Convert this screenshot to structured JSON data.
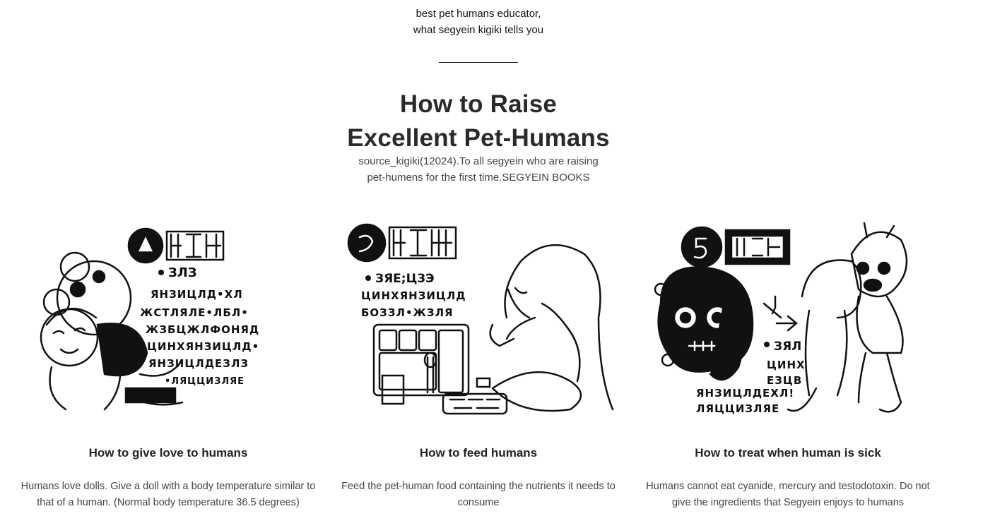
{
  "intro": {
    "line1": "best pet humans educator,",
    "line2": "what segyein kigiki tells you"
  },
  "title": {
    "line1": "How to Raise",
    "line2": "Excellent Pet-Humans"
  },
  "subtitle": {
    "line1": "source_kigiki(12024).To all segyein who are raising",
    "line2": "pet-humens for the first time.SEGYEIN BOOKS"
  },
  "cards": [
    {
      "heading": "How to give love to humans",
      "text": "Humans love dolls. Give a doll with a body temperature similar to that of a human. (Normal body temperature 36.5 degrees)",
      "illustration": "hugging-doll-illustration"
    },
    {
      "heading": "How to feed humans",
      "text": "Feed the pet-human food containing the nutrients it needs to consume",
      "illustration": "feeding-tray-illustration"
    },
    {
      "heading": "How to treat when human is sick",
      "text": "Humans cannot eat cyanide, mercury and testodotoxin. Do not give the ingredients that Segyein enjoys to humans",
      "illustration": "sick-skull-illustration"
    }
  ]
}
